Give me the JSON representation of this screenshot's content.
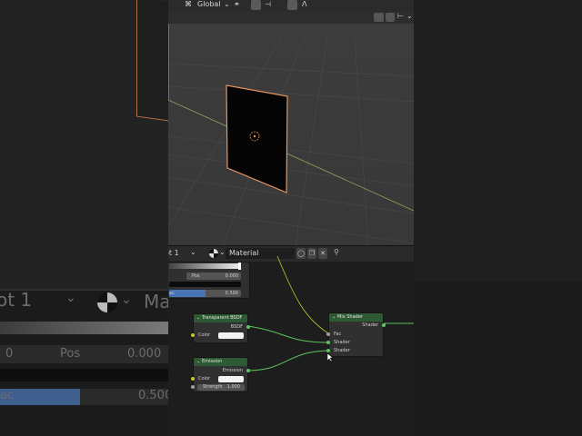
{
  "viewport_header": {
    "transform_orientation": "Global"
  },
  "node_editor_header": {
    "slot_label": "ot 1",
    "material_name": "Material"
  },
  "ramp_node": {
    "pos_label": "Pos",
    "pos_value": "0.000",
    "fac_value": "0.500",
    "fac_label": "ac",
    "fac_fraction": 0.5
  },
  "transparent_bsdf_node": {
    "title": "Transparent BSDF",
    "output": "BSDF",
    "color_label": "Color"
  },
  "emission_node": {
    "title": "Emission",
    "output": "Emission",
    "color_label": "Color",
    "strength_label": "Strength",
    "strength_value": "1.000"
  },
  "mix_shader_node": {
    "title": "Mix Shader",
    "output": "Shader",
    "inputs": [
      "Fac",
      "Shader",
      "Shader"
    ]
  },
  "background_zoom": {
    "slot_label": "ot 1",
    "material_fragment": "Ma",
    "pos_value": "0",
    "pos_label": "Pos",
    "pos_number": "0.000",
    "fac_label": "ac",
    "fac_value": "0.500"
  },
  "colors": {
    "selection_outline": "#e8955a",
    "node_header": "#2e5a33",
    "node_link": "#5ec25e",
    "fac_link": "#c7c729",
    "fac_bar": "#4772b3"
  }
}
